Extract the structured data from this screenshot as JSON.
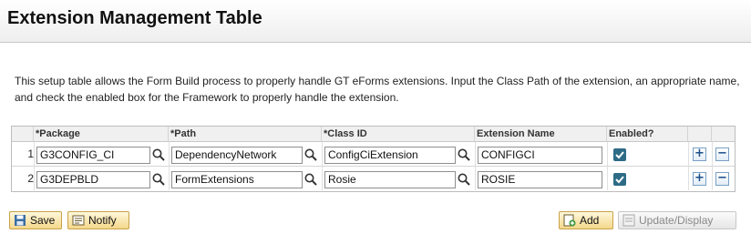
{
  "page": {
    "title": "Extension Management Table",
    "instructions": "This setup table allows the Form Build process to properly handle GT eForms extensions. Input the Class Path of the extension, an appropriate name, and check the enabled box for the Framework to properly handle the extension."
  },
  "grid": {
    "columns": {
      "package": "*Package",
      "path": "*Path",
      "class_id": "*Class ID",
      "extension_name": "Extension Name",
      "enabled": "Enabled?"
    },
    "rows": [
      {
        "num": "1",
        "package": "G3CONFIG_CI",
        "path": "DependencyNetwork",
        "class_id": "ConfigCiExtension",
        "extension_name": "CONFIGCI",
        "enabled": true
      },
      {
        "num": "2",
        "package": "G3DEPBLD",
        "path": "FormExtensions",
        "class_id": "Rosie",
        "extension_name": "ROSIE",
        "enabled": true
      }
    ],
    "add_row_symbol": "+",
    "delete_row_symbol": "−"
  },
  "toolbar": {
    "save_label": "Save",
    "notify_label": "Notify",
    "add_label": "Add",
    "update_display_label": "Update/Display"
  },
  "colors": {
    "checkbox": "#2d6b86",
    "button_gradient_top": "#fff8dc",
    "button_gradient_bottom": "#f4d78a"
  },
  "icons": [
    "lookup-icon",
    "checkbox-checked-icon",
    "add-row-icon",
    "delete-row-icon",
    "save-icon",
    "notify-icon",
    "add-icon",
    "update-display-icon"
  ]
}
